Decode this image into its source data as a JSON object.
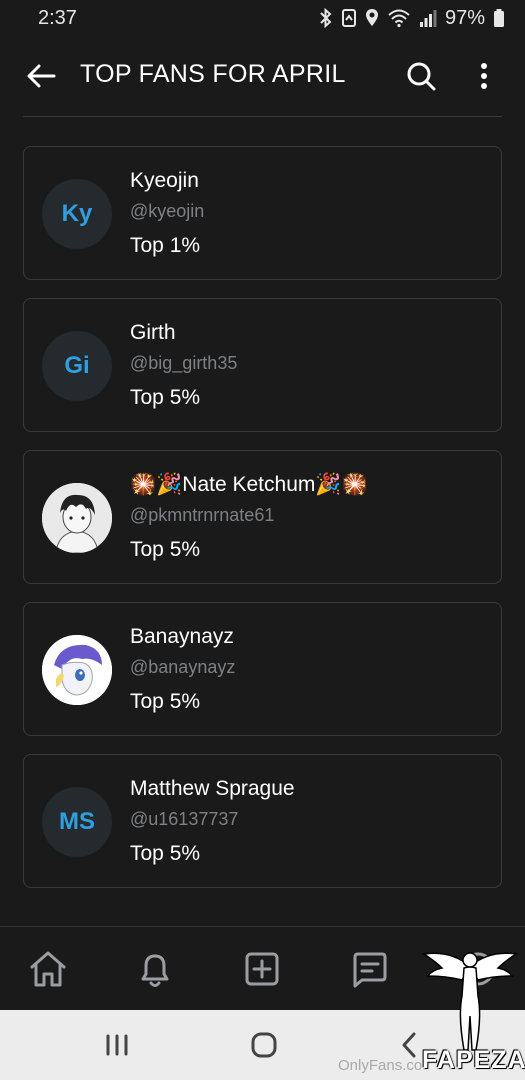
{
  "status_bar": {
    "time": "2:37",
    "battery": "97%"
  },
  "header": {
    "title": "TOP FANS FOR APRIL"
  },
  "fans": [
    {
      "initials": "Ky",
      "name": "Kyeojin",
      "handle": "@kyeojin",
      "rank": "Top 1%",
      "avatar": "initials"
    },
    {
      "initials": "Gi",
      "name": "Girth",
      "handle": "@big_girth35",
      "rank": "Top 5%",
      "avatar": "initials"
    },
    {
      "initials": "",
      "name": "🎇🎉Nate Ketchum🎉🎇",
      "handle": "@pkmntrnrnate61",
      "rank": "Top 5%",
      "avatar": "photo-anime-boy"
    },
    {
      "initials": "",
      "name": "Banaynayz",
      "handle": "@banaynayz",
      "rank": "Top 5%",
      "avatar": "photo-pony"
    },
    {
      "initials": "MS",
      "name": "Matthew Sprague",
      "handle": "@u16137737",
      "rank": "Top 5%",
      "avatar": "initials"
    }
  ],
  "bottom_nav": [
    "home-icon",
    "bell-icon",
    "add-icon",
    "messages-icon",
    "profile-icon"
  ],
  "watermark": {
    "site": "OnlyFans.co",
    "logo": "FAPEZA"
  },
  "colors": {
    "background": "#1a1a1a",
    "accent": "#2f9fe0",
    "border": "#3a3a3a",
    "muted": "#7d8185"
  }
}
